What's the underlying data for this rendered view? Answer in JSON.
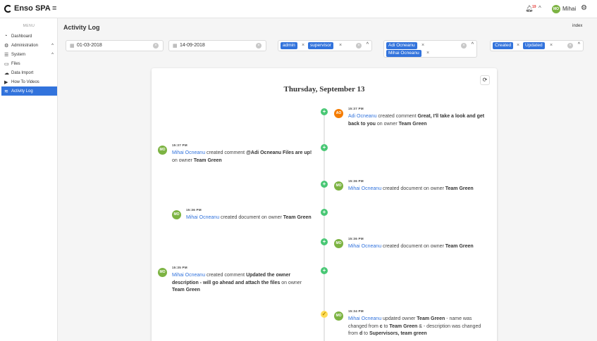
{
  "app": {
    "name": "Enso SPA"
  },
  "navbar": {
    "notification_count": "19",
    "user_initials": "MO",
    "user_name": "Mihai"
  },
  "sidebar": {
    "menu_label": "MENU",
    "items": [
      {
        "label": "Dashboard",
        "icon": "tachometer-icon"
      },
      {
        "label": "Administration",
        "icon": "cogs-icon"
      },
      {
        "label": "System",
        "icon": "list-icon"
      },
      {
        "label": "Files",
        "icon": "folder-icon"
      },
      {
        "label": "Data Import",
        "icon": "cloud-upload-icon"
      },
      {
        "label": "How To Videos",
        "icon": "video-icon"
      },
      {
        "label": "Activity Log",
        "icon": "activity-icon"
      }
    ]
  },
  "page": {
    "title": "Activity Log",
    "index_link": "index"
  },
  "filters": {
    "date_from": "01-03-2018",
    "date_to": "14-09-2018",
    "roles": [
      "admin",
      "supervisor"
    ],
    "users": [
      "Adi Ocneanu",
      "Mihai Ocneanu"
    ],
    "events": [
      "Created",
      "Updated"
    ]
  },
  "timeline": {
    "day": "Thursday, September 13",
    "entries": [
      {
        "time": "15:37 PM",
        "initials": "AO",
        "user": "Adi Ocneanu",
        "action": " created comment ",
        "detail": "Great, I'll take a look and get back to you",
        "suffix": " on owner ",
        "target": "Team Green"
      },
      {
        "time": "15:37 PM",
        "initials": "MO",
        "user": "Mihai Ocneanu",
        "action": " created comment ",
        "detail": "@Adi Ocneanu Files are up!",
        "suffix": " on owner ",
        "target": "Team Green"
      },
      {
        "time": "15:36 PM",
        "initials": "MO",
        "user": "Mihai Ocneanu",
        "action": " created document on owner ",
        "target": "Team Green"
      },
      {
        "time": "15:36 PM",
        "initials": "MO",
        "user": "Mihai Ocneanu",
        "action": " created document on owner ",
        "target": "Team Green"
      },
      {
        "time": "15:36 PM",
        "initials": "MO",
        "user": "Mihai Ocneanu",
        "action": " created document on owner ",
        "target": "Team Green"
      },
      {
        "time": "15:35 PM",
        "initials": "MO",
        "user": "Mihai Ocneanu",
        "action": " created comment ",
        "detail": "Updated the owner description - will go ahead and attach the files",
        "suffix": " on owner ",
        "target": "Team Green"
      },
      {
        "time": "15:34 PM",
        "initials": "MO",
        "user": "Mihai Ocneanu",
        "action": " updated owner ",
        "target": "Team Green",
        "t1": " - name was changed from ",
        "from1": "c",
        "t2": " to ",
        "to1": "Team Green",
        "t3": " & - description was changed from ",
        "from2": "d",
        "t4": " to ",
        "to2": "Supervisors, team green"
      }
    ]
  },
  "colors": {
    "primary": "#3273dc",
    "created": "#48c774",
    "updated": "#ffdd57",
    "avatar_green": "#7cb342",
    "avatar_orange": "#f57c00"
  }
}
